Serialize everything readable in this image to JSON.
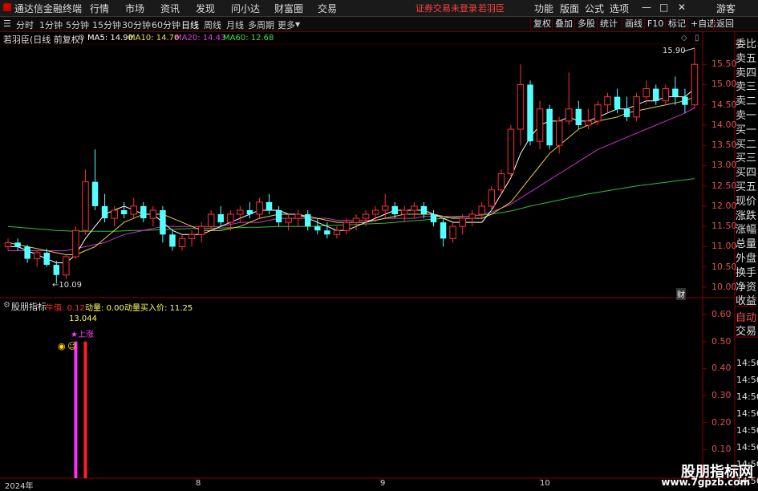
{
  "app": {
    "title": "通达信金融终端",
    "menus": [
      "行情",
      "市场",
      "资讯",
      "发现",
      "问小达",
      "财富圈",
      "交易"
    ],
    "warning": "证券交易未登录",
    "user": "若羽臣",
    "right_menus": [
      "功能",
      "版面",
      "公式",
      "选项"
    ],
    "guest": "游客"
  },
  "toolbar": {
    "periods": [
      "分时",
      "1分钟",
      "5分钟",
      "15分钟",
      "30分钟",
      "60分钟",
      "日线",
      "周线",
      "月线",
      "多周期",
      "更多"
    ],
    "active_period": "日线",
    "buttons": [
      "复权",
      "叠加",
      "多股",
      "统计",
      "画线",
      "F10",
      "标记",
      "+自选",
      "返回"
    ]
  },
  "main_chart": {
    "stock_label": "若羽臣(日线 前复权)",
    "ma_values": [
      {
        "name": "MA5",
        "value": "14.90",
        "color": "#ffffff"
      },
      {
        "name": "MA10",
        "value": "14.70",
        "color": "#f0e040"
      },
      {
        "name": "MA20",
        "value": "14.43",
        "color": "#e040e0"
      },
      {
        "name": "MA60",
        "value": "12.68",
        "color": "#40e040"
      }
    ],
    "y_ticks": [
      "15.50",
      "15.00",
      "14.50",
      "14.00",
      "13.50",
      "13.00",
      "12.50",
      "12.00",
      "11.50",
      "11.00",
      "10.50",
      "10.00"
    ],
    "y_range": [
      9.8,
      16.0
    ],
    "high_label": "15.90",
    "low_label": "10.09",
    "fin_marker": "财"
  },
  "indicator": {
    "name": "股朋指标",
    "fields": [
      {
        "label": "牛值",
        "value": "0.12",
        "color": "#ff3030"
      },
      {
        "label": "动量",
        "value": "0.00",
        "color": "#ffff60"
      },
      {
        "label": "动量买入价",
        "value": "11.25",
        "color": "#ffff60"
      }
    ],
    "annotation_value": "13.044",
    "annotation_text": "★上涨",
    "y_ticks": [
      "0.60",
      "0.50",
      "0.40",
      "0.30",
      "0.20",
      "0.10"
    ]
  },
  "x_axis": [
    "2024年",
    "8",
    "9",
    "10"
  ],
  "side_panel": {
    "items": [
      "委比",
      "卖五",
      "卖四",
      "卖三",
      "卖二",
      "卖一",
      "买一",
      "买二",
      "买三",
      "买四",
      "买五",
      "现价",
      "涨跌",
      "涨幅",
      "总量",
      "外盘",
      "换手",
      "净资",
      "收益"
    ],
    "bottom_items": [
      "自动",
      "交易"
    ],
    "times": [
      "14:56",
      "14:56",
      "14:56",
      "14:56",
      "14:56",
      "14:56",
      "14:56",
      "14:56"
    ]
  },
  "watermark": {
    "line1": "股朋指标网",
    "line2": "www.7gpzb.com"
  },
  "chart_data": {
    "type": "candlestick",
    "up_color": "#ff3030",
    "down_color": "#54ffff",
    "ohlc": [
      [
        11.0,
        11.2,
        10.9,
        11.1
      ],
      [
        11.1,
        11.2,
        10.9,
        11.0
      ],
      [
        11.0,
        11.05,
        10.6,
        10.7
      ],
      [
        10.7,
        10.9,
        10.5,
        10.85
      ],
      [
        10.85,
        10.95,
        10.5,
        10.55
      ],
      [
        10.55,
        10.65,
        10.09,
        10.3
      ],
      [
        10.3,
        10.8,
        10.2,
        10.75
      ],
      [
        10.75,
        11.5,
        10.7,
        11.4
      ],
      [
        11.4,
        12.9,
        11.3,
        12.6
      ],
      [
        12.6,
        13.4,
        11.9,
        12.0
      ],
      [
        12.0,
        12.3,
        11.6,
        11.7
      ],
      [
        11.7,
        12.0,
        11.5,
        11.9
      ],
      [
        11.9,
        12.1,
        11.7,
        11.8
      ],
      [
        11.8,
        12.2,
        11.7,
        12.0
      ],
      [
        12.0,
        12.1,
        11.6,
        11.7
      ],
      [
        11.7,
        12.0,
        11.5,
        11.9
      ],
      [
        11.9,
        12.0,
        11.1,
        11.3
      ],
      [
        11.3,
        11.4,
        10.9,
        11.0
      ],
      [
        11.0,
        11.3,
        10.9,
        11.2
      ],
      [
        11.2,
        11.4,
        11.0,
        11.3
      ],
      [
        11.3,
        11.6,
        11.1,
        11.5
      ],
      [
        11.5,
        11.9,
        11.4,
        11.8
      ],
      [
        11.8,
        12.0,
        11.5,
        11.6
      ],
      [
        11.6,
        11.9,
        11.4,
        11.8
      ],
      [
        11.8,
        12.0,
        11.6,
        11.9
      ],
      [
        11.9,
        12.1,
        11.7,
        11.8
      ],
      [
        11.8,
        12.2,
        11.7,
        12.1
      ],
      [
        12.1,
        12.3,
        11.8,
        11.9
      ],
      [
        11.9,
        12.0,
        11.5,
        11.6
      ],
      [
        11.6,
        11.8,
        11.4,
        11.7
      ],
      [
        11.7,
        11.9,
        11.5,
        11.8
      ],
      [
        11.8,
        11.9,
        11.4,
        11.5
      ],
      [
        11.5,
        11.7,
        11.3,
        11.4
      ],
      [
        11.4,
        11.6,
        11.2,
        11.3
      ],
      [
        11.3,
        11.5,
        11.2,
        11.4
      ],
      [
        11.4,
        11.7,
        11.3,
        11.6
      ],
      [
        11.6,
        11.8,
        11.4,
        11.7
      ],
      [
        11.7,
        11.9,
        11.5,
        11.8
      ],
      [
        11.8,
        12.0,
        11.6,
        11.9
      ],
      [
        11.9,
        12.3,
        11.7,
        12.0
      ],
      [
        12.0,
        12.1,
        11.7,
        11.8
      ],
      [
        11.8,
        12.0,
        11.6,
        11.9
      ],
      [
        11.9,
        12.1,
        11.7,
        12.0
      ],
      [
        12.0,
        12.1,
        11.7,
        11.8
      ],
      [
        11.8,
        11.9,
        11.5,
        11.6
      ],
      [
        11.6,
        11.7,
        11.0,
        11.2
      ],
      [
        11.2,
        11.6,
        11.1,
        11.5
      ],
      [
        11.5,
        11.8,
        11.3,
        11.7
      ],
      [
        11.7,
        11.9,
        11.5,
        11.8
      ],
      [
        11.8,
        12.1,
        11.7,
        12.0
      ],
      [
        12.0,
        12.5,
        11.9,
        12.4
      ],
      [
        12.4,
        12.9,
        12.3,
        12.8
      ],
      [
        12.8,
        14.0,
        12.7,
        13.9
      ],
      [
        13.9,
        15.5,
        13.5,
        15.0
      ],
      [
        15.0,
        15.1,
        13.5,
        13.6
      ],
      [
        13.6,
        14.6,
        13.4,
        14.4
      ],
      [
        14.4,
        14.5,
        13.4,
        13.5
      ],
      [
        13.5,
        14.2,
        13.3,
        14.1
      ],
      [
        14.1,
        15.3,
        14.0,
        14.4
      ],
      [
        14.4,
        14.6,
        13.9,
        14.0
      ],
      [
        14.0,
        14.4,
        13.9,
        14.1
      ],
      [
        14.1,
        14.6,
        14.0,
        14.5
      ],
      [
        14.5,
        14.8,
        14.3,
        14.7
      ],
      [
        14.7,
        14.9,
        14.3,
        14.4
      ],
      [
        14.4,
        14.7,
        14.1,
        14.2
      ],
      [
        14.2,
        14.8,
        14.1,
        14.7
      ],
      [
        14.7,
        15.1,
        14.5,
        14.9
      ],
      [
        14.9,
        15.0,
        14.5,
        14.6
      ],
      [
        14.6,
        15.0,
        14.5,
        14.9
      ],
      [
        14.9,
        15.2,
        14.5,
        14.7
      ],
      [
        14.7,
        14.9,
        14.3,
        14.5
      ],
      [
        14.5,
        15.9,
        14.4,
        15.5
      ]
    ],
    "ma5": [
      11.0,
      11.0,
      10.9,
      10.8,
      10.7,
      10.6,
      10.6,
      10.8,
      11.2,
      11.5,
      11.8,
      11.9,
      12.0,
      11.9,
      11.8,
      11.8,
      11.6,
      11.4,
      11.3,
      11.3,
      11.3,
      11.4,
      11.5,
      11.6,
      11.7,
      11.8,
      11.9,
      11.9,
      11.9,
      11.8,
      11.8,
      11.7,
      11.6,
      11.5,
      11.4,
      11.4,
      11.5,
      11.6,
      11.7,
      11.8,
      11.9,
      11.9,
      11.9,
      11.9,
      11.8,
      11.7,
      11.6,
      11.6,
      11.6,
      11.6,
      11.9,
      12.3,
      12.7,
      13.3,
      13.7,
      14.0,
      14.1,
      14.1,
      14.2,
      14.1,
      14.1,
      14.2,
      14.3,
      14.4,
      14.4,
      14.5,
      14.6,
      14.6,
      14.7,
      14.7,
      14.7,
      14.9
    ],
    "ma10": [
      11.1,
      11.05,
      11.0,
      10.95,
      10.9,
      10.85,
      10.8,
      10.8,
      10.9,
      11.0,
      11.2,
      11.4,
      11.6,
      11.7,
      11.8,
      11.8,
      11.8,
      11.7,
      11.6,
      11.5,
      11.4,
      11.4,
      11.4,
      11.45,
      11.5,
      11.6,
      11.7,
      11.75,
      11.8,
      11.8,
      11.8,
      11.75,
      11.7,
      11.65,
      11.6,
      11.6,
      11.6,
      11.6,
      11.65,
      11.7,
      11.75,
      11.8,
      11.8,
      11.8,
      11.8,
      11.75,
      11.7,
      11.7,
      11.7,
      11.7,
      11.8,
      11.95,
      12.1,
      12.4,
      12.7,
      13.0,
      13.3,
      13.5,
      13.7,
      13.9,
      14.0,
      14.1,
      14.15,
      14.2,
      14.3,
      14.35,
      14.4,
      14.45,
      14.5,
      14.55,
      14.6,
      14.7
    ],
    "ma20": [
      10.9,
      10.9,
      10.9,
      10.9,
      10.9,
      10.9,
      10.9,
      10.95,
      11.0,
      11.05,
      11.1,
      11.2,
      11.3,
      11.35,
      11.4,
      11.45,
      11.5,
      11.5,
      11.5,
      11.5,
      11.5,
      11.5,
      11.5,
      11.55,
      11.6,
      11.6,
      11.6,
      11.65,
      11.7,
      11.7,
      11.7,
      11.7,
      11.7,
      11.7,
      11.65,
      11.65,
      11.65,
      11.65,
      11.65,
      11.7,
      11.7,
      11.7,
      11.7,
      11.75,
      11.75,
      11.75,
      11.75,
      11.75,
      11.75,
      11.8,
      11.85,
      11.95,
      12.05,
      12.2,
      12.35,
      12.5,
      12.65,
      12.8,
      12.95,
      13.1,
      13.25,
      13.4,
      13.5,
      13.6,
      13.7,
      13.8,
      13.9,
      14.0,
      14.1,
      14.2,
      14.3,
      14.43
    ],
    "ma60": [
      11.5,
      11.48,
      11.46,
      11.44,
      11.42,
      11.4,
      11.39,
      11.38,
      11.38,
      11.38,
      11.38,
      11.38,
      11.39,
      11.4,
      11.4,
      11.41,
      11.42,
      11.43,
      11.44,
      11.45,
      11.45,
      11.46,
      11.46,
      11.47,
      11.47,
      11.48,
      11.48,
      11.49,
      11.5,
      11.5,
      11.5,
      11.5,
      11.51,
      11.52,
      11.53,
      11.54,
      11.55,
      11.56,
      11.57,
      11.58,
      11.6,
      11.62,
      11.64,
      11.66,
      11.68,
      11.7,
      11.72,
      11.74,
      11.76,
      11.78,
      11.8,
      11.84,
      11.88,
      11.94,
      12.0,
      12.05,
      12.1,
      12.15,
      12.2,
      12.25,
      12.3,
      12.34,
      12.38,
      12.42,
      12.46,
      12.5,
      12.53,
      12.56,
      12.59,
      12.62,
      12.65,
      12.68
    ],
    "indicator_bars": [
      {
        "index": 7,
        "value": 0.5,
        "color": "#ff30ff"
      },
      {
        "index": 8,
        "value": 0.5,
        "color": "#ff2020"
      }
    ]
  }
}
